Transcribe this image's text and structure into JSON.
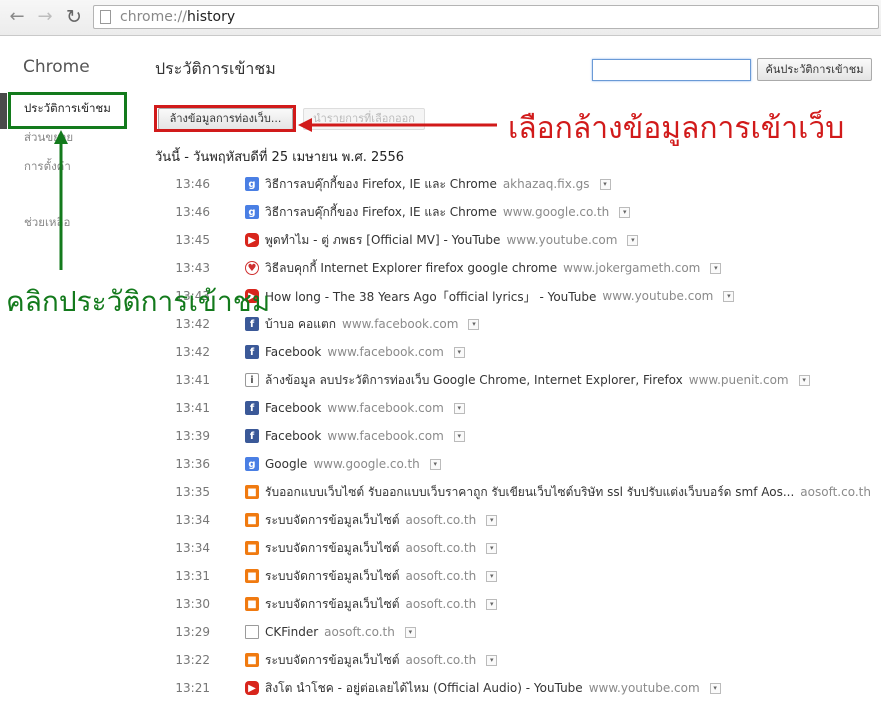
{
  "browser": {
    "url_scheme": "chrome://",
    "url_path": "history"
  },
  "sidebar": {
    "brand": "Chrome",
    "items": [
      {
        "label": "ประวัติการเข้าชม"
      },
      {
        "label": "ส่วนขยาย"
      },
      {
        "label": "การตั้งค่า"
      },
      {
        "label": "ช่วยเหลือ"
      }
    ]
  },
  "main": {
    "title": "ประวัติการเข้าชม",
    "search_value": "",
    "search_button": "ค้นประวัติการเข้าชม",
    "clear_button": "ล้างข้อมูลการท่องเว็บ...",
    "remove_button": "นำรายการที่เลือกออก",
    "day_header": "วันนี้ - วันพฤหัสบดีที่ 25 เมษายน พ.ศ. 2556"
  },
  "entries": [
    {
      "time": "13:46",
      "icon": "google",
      "title": "วิธีการลบคุ๊กกี้ของ Firefox, IE และ Chrome",
      "domain": "akhazaq.fix.gs"
    },
    {
      "time": "13:46",
      "icon": "google",
      "title": "วิธีการลบคุ๊กกี้ของ Firefox, IE และ Chrome",
      "domain": "www.google.co.th"
    },
    {
      "time": "13:45",
      "icon": "youtube",
      "title": "พูดทำไม - ตู่ ภพธร [Official MV] - YouTube",
      "domain": "www.youtube.com"
    },
    {
      "time": "13:43",
      "icon": "joker",
      "title": "วิธีลบคุกกี้ Internet Explorer firefox google chrome",
      "domain": "www.jokergameth.com"
    },
    {
      "time": "13:43",
      "icon": "youtube",
      "title": "How long - The 38 Years Ago「official lyrics」 - YouTube",
      "domain": "www.youtube.com"
    },
    {
      "time": "13:42",
      "icon": "facebook",
      "title": "บ้าบอ คอแตก",
      "domain": "www.facebook.com"
    },
    {
      "time": "13:42",
      "icon": "facebook",
      "title": "Facebook",
      "domain": "www.facebook.com"
    },
    {
      "time": "13:41",
      "icon": "puenit",
      "title": "ล้างข้อมูล ลบประวัติการท่องเว็บ Google Chrome, Internet Explorer, Firefox",
      "domain": "www.puenit.com"
    },
    {
      "time": "13:41",
      "icon": "facebook",
      "title": "Facebook",
      "domain": "www.facebook.com"
    },
    {
      "time": "13:39",
      "icon": "facebook",
      "title": "Facebook",
      "domain": "www.facebook.com"
    },
    {
      "time": "13:36",
      "icon": "google",
      "title": "Google",
      "domain": "www.google.co.th"
    },
    {
      "time": "13:35",
      "icon": "aosoft",
      "title": "รับออกแบบเว็บไซต์ รับออกแบบเว็บราคาถูก รับเขียนเว็บไซต์บริษัท ssl รับปรับแต่งเว็บบอร์ด smf Aos...",
      "domain": "aosoft.co.th"
    },
    {
      "time": "13:34",
      "icon": "aosoft",
      "title": "ระบบจัดการข้อมูลเว็บไซต์",
      "domain": "aosoft.co.th"
    },
    {
      "time": "13:34",
      "icon": "aosoft",
      "title": "ระบบจัดการข้อมูลเว็บไซต์",
      "domain": "aosoft.co.th"
    },
    {
      "time": "13:31",
      "icon": "aosoft",
      "title": "ระบบจัดการข้อมูลเว็บไซต์",
      "domain": "aosoft.co.th"
    },
    {
      "time": "13:30",
      "icon": "aosoft",
      "title": "ระบบจัดการข้อมูลเว็บไซต์",
      "domain": "aosoft.co.th"
    },
    {
      "time": "13:29",
      "icon": "doc",
      "title": "CKFinder",
      "domain": "aosoft.co.th"
    },
    {
      "time": "13:22",
      "icon": "aosoft",
      "title": "ระบบจัดการข้อมูลเว็บไซต์",
      "domain": "aosoft.co.th"
    },
    {
      "time": "13:21",
      "icon": "youtube",
      "title": "สิงโต นำโชค - อยู่ต่อเลยได้ไหม (Official Audio) - YouTube",
      "domain": "www.youtube.com"
    }
  ],
  "annotations": {
    "red_text": "เลือกล้างข้อมูลการเข้าเว็บ",
    "green_text": "คลิกประวัติการเข้าชม",
    "red_color": "#d11a1a",
    "green_color": "#137a1c"
  }
}
